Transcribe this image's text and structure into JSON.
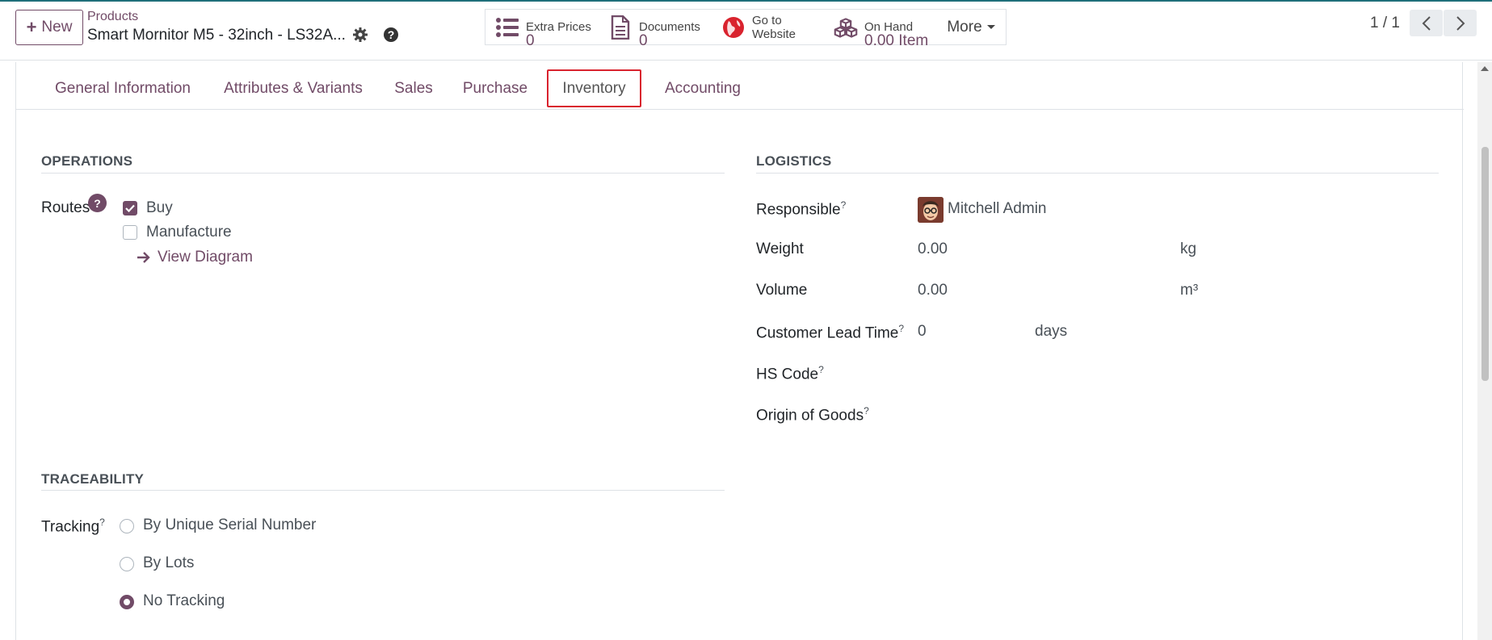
{
  "control_panel": {
    "new_button_label": "New",
    "breadcrumb_parent": "Products",
    "record_title": "Smart Mornitor M5 - 32inch - LS32A...",
    "smart_buttons": {
      "extra_prices": {
        "label": "Extra Prices",
        "value": "0"
      },
      "documents": {
        "label": "Documents",
        "value": "0"
      },
      "website": {
        "line1": "Go to",
        "line2": "Website"
      },
      "on_hand": {
        "label": "On Hand",
        "value": "0.00",
        "unit": "Item"
      },
      "more": "More"
    },
    "pager": "1 / 1"
  },
  "tabs": [
    {
      "label": "General Information"
    },
    {
      "label": "Attributes & Variants"
    },
    {
      "label": "Sales"
    },
    {
      "label": "Purchase"
    },
    {
      "label": "Inventory"
    },
    {
      "label": "Accounting"
    }
  ],
  "active_tab": "Inventory",
  "operations": {
    "title": "OPERATIONS",
    "routes_label": "Routes",
    "help_badge": "?",
    "routes": [
      {
        "label": "Buy",
        "checked": true
      },
      {
        "label": "Manufacture",
        "checked": false
      }
    ],
    "view_diagram": "View Diagram"
  },
  "logistics": {
    "title": "LOGISTICS",
    "responsible_label": "Responsible",
    "responsible_value": "Mitchell Admin",
    "weight_label": "Weight",
    "weight_value": "0.00",
    "weight_unit": "kg",
    "volume_label": "Volume",
    "volume_value": "0.00",
    "volume_unit": "m³",
    "lead_time_label": "Customer Lead Time",
    "lead_time_value": "0",
    "lead_time_unit": "days",
    "hs_code_label": "HS Code",
    "origin_label": "Origin of Goods",
    "tooltip_mark": "?"
  },
  "traceability": {
    "title": "TRACEABILITY",
    "tracking_label": "Tracking",
    "options": [
      {
        "label": "By Unique Serial Number",
        "checked": false
      },
      {
        "label": "By Lots",
        "checked": false
      },
      {
        "label": "No Tracking",
        "checked": true
      }
    ]
  },
  "colors": {
    "brand": "#714b67",
    "highlight": "#d9232e"
  }
}
